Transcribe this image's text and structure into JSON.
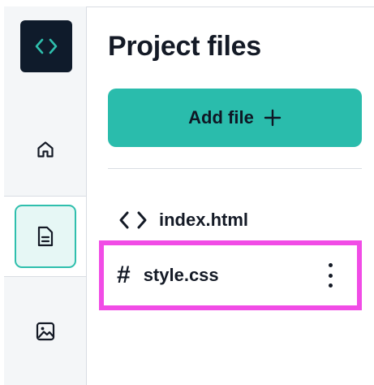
{
  "sidebar": {
    "logo_icon": "code-brackets-icon",
    "items": [
      {
        "icon": "home-icon"
      },
      {
        "icon": "file-icon",
        "active": true
      },
      {
        "icon": "image-icon"
      }
    ]
  },
  "main": {
    "title": "Project files",
    "add_button": {
      "label": "Add file",
      "icon": "plus-icon"
    },
    "files": [
      {
        "name": "index.html",
        "icon": "code-brackets-icon"
      },
      {
        "name": "style.css",
        "icon_glyph": "#",
        "icon": "hash-icon",
        "highlighted": true,
        "menu_icon": "kebab-menu-icon"
      }
    ]
  },
  "colors": {
    "accent": "#2abcac",
    "logo_bg": "#0f1b2b",
    "active_border": "#2fbfad",
    "highlight": "#f14ce6"
  }
}
